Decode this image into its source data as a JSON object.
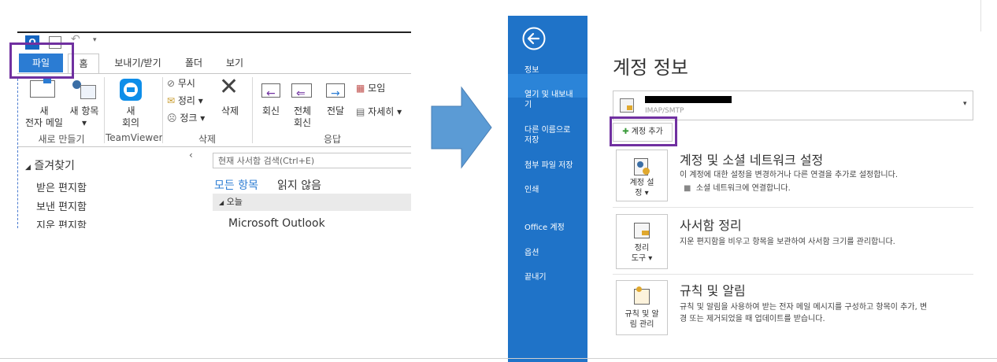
{
  "ribbon": {
    "tabs": [
      "파일",
      "홈",
      "보내기/받기",
      "폴더",
      "보기"
    ],
    "new_email": [
      "새",
      "전자 메일"
    ],
    "new_items": "새 항목",
    "group_new": "새로 만들기",
    "new_meeting": [
      "새",
      "회의"
    ],
    "group_teamviewer": "TeamViewer",
    "ignore": "무시",
    "cleanup": "정리",
    "junk": "정크",
    "delete": "삭제",
    "group_delete": "삭제",
    "reply": "회신",
    "reply_all": [
      "전체",
      "회신"
    ],
    "forward": "전달",
    "meeting": "모임",
    "more": "자세히",
    "group_respond": "응답"
  },
  "folders": {
    "favorites": "즐겨찾기",
    "items": [
      "받은 편지함",
      "보낸 편지함",
      "지운 편지함"
    ]
  },
  "mail": {
    "search_placeholder": "현재 사서함 검색(Ctrl+E)",
    "filter_all": "모든 항목",
    "filter_unread": "읽지 않음",
    "group_today": "오늘",
    "first_sender": "Microsoft Outlook"
  },
  "backstage": {
    "menu": [
      "정보",
      "열기 및 내보내기",
      "다른 이름으로 저장",
      "첨부 파일 저장",
      "인쇄",
      "Office 계정",
      "옵션",
      "끝내기"
    ],
    "title": "계정 정보",
    "account_type": "IMAP/SMTP",
    "add_account": "계정 추가",
    "sections": [
      {
        "btn": [
          "계정 설",
          "정 ▾"
        ],
        "title": "계정 및 소셜 네트워크 설정",
        "desc": "이 계정에 대한 설정을 변경하거나 다른 연결을 추가로 설정합니다.",
        "bullet": "소셜 네트워크에 연결합니다."
      },
      {
        "btn": [
          "정리",
          "도구 ▾"
        ],
        "title": "사서함 정리",
        "desc": "지운 편지함을 비우고 항목을 보관하여 사서함 크기를 관리합니다."
      },
      {
        "btn": [
          "규칙 및 알",
          "림 관리"
        ],
        "title": "규칙 및 알림",
        "desc": "규칙 및 알림을 사용하여 받는 전자 메일 메시지를 구성하고 항목이 추가, 변",
        "desc2": "경 또는 제거되었을 때 업데이트를 받습니다."
      }
    ]
  },
  "colors": {
    "backstage_blue": "#1f73c8",
    "file_tab_blue": "#2b7cd3",
    "highlight_purple": "#7030a0",
    "arrow_blue": "#5b9bd5"
  }
}
